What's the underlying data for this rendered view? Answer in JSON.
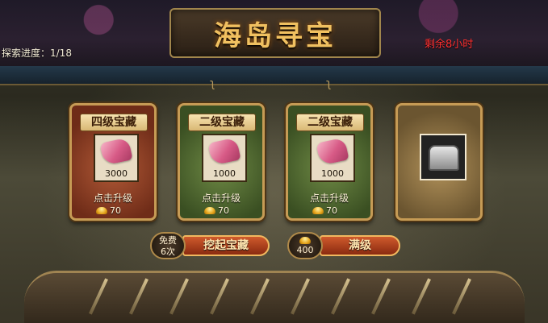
{
  "header": {
    "title": "海岛寻宝",
    "time_left": "剩余8小时",
    "progress": "探索进度：1/18"
  },
  "cards": [
    {
      "title": "四级宝藏",
      "value": "3000",
      "upgrade": "点击升级",
      "cost": "70",
      "style": "red"
    },
    {
      "title": "二级宝藏",
      "value": "1000",
      "upgrade": "点击升级",
      "cost": "70",
      "style": "green"
    },
    {
      "title": "二级宝藏",
      "value": "1000",
      "upgrade": "点击升级",
      "cost": "70",
      "style": "green"
    },
    {
      "style": "gold",
      "icon": "treasure-chest-icon"
    }
  ],
  "actions": {
    "free_label": "免费",
    "free_count": "6次",
    "dig_label": "挖起宝藏",
    "max_price": "400",
    "max_label": "满级"
  },
  "colors": {
    "title_gold": "#f0c060",
    "time_red": "#ff3030",
    "button_red": "#cf5a2c"
  }
}
